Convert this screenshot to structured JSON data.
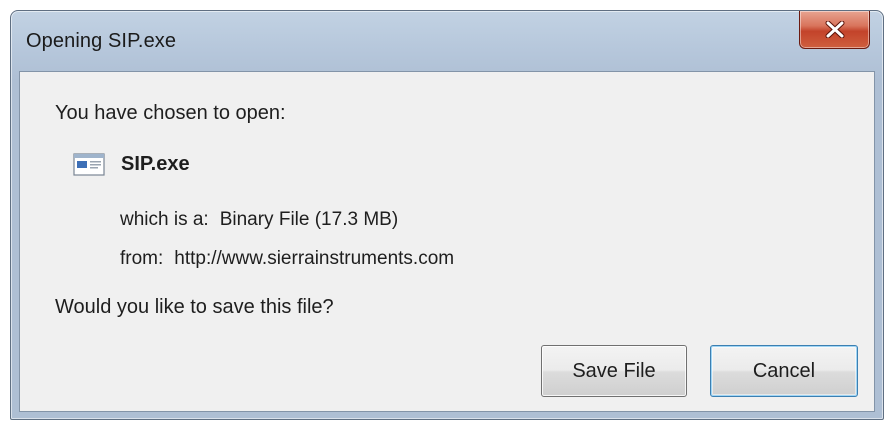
{
  "window": {
    "title": "Opening SIP.exe",
    "close_glyph": "X"
  },
  "dialog": {
    "prompt": "You have chosen to open:",
    "file": {
      "icon": "application-window-icon",
      "name": "SIP.exe"
    },
    "type_label": "which is a:",
    "type_value": "Binary File (17.3 MB)",
    "from_label": "from:",
    "from_value": "http://www.sierrainstruments.com",
    "question": "Would you like to save this file?"
  },
  "buttons": {
    "save": "Save File",
    "cancel": "Cancel"
  },
  "colors": {
    "frame": "#b7c8dc",
    "close_button": "#c3432a",
    "client_background": "#f0f0f0",
    "default_button_border": "#3c7fb1"
  }
}
